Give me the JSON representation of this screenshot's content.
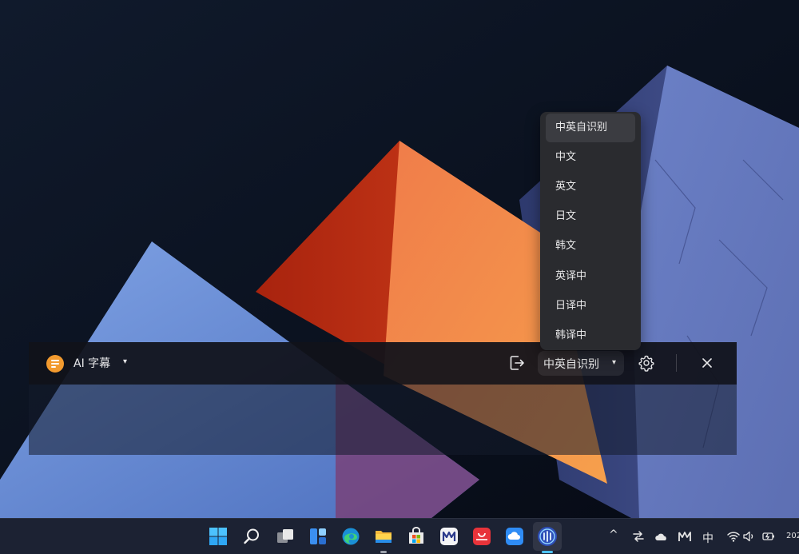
{
  "colors": {
    "accent_orange": "#f29a2e",
    "toolbar_bg": "#101218",
    "dropdown_bg": "#2a2b2f",
    "dropdown_selected": "#3b3c41",
    "taskbar_bg": "#1c2233"
  },
  "subtitle_bar": {
    "logo_icon": "subtitle-logo-icon",
    "title": "AI 字幕",
    "title_caret": "▾",
    "exit_icon": "exit-icon",
    "language_value": "中英自识别",
    "language_caret": "▾",
    "settings_icon": "gear-icon",
    "close_icon": "close-icon"
  },
  "language_dropdown": {
    "items": [
      {
        "label": "中英自识别",
        "selected": true
      },
      {
        "label": "中文",
        "selected": false
      },
      {
        "label": "英文",
        "selected": false
      },
      {
        "label": "日文",
        "selected": false
      },
      {
        "label": "韩文",
        "selected": false
      },
      {
        "label": "英译中",
        "selected": false
      },
      {
        "label": "日译中",
        "selected": false
      },
      {
        "label": "韩译中",
        "selected": false
      }
    ]
  },
  "taskbar": {
    "apps": [
      {
        "name": "start-icon"
      },
      {
        "name": "search-icon"
      },
      {
        "name": "task-view-icon"
      },
      {
        "name": "widgets-icon"
      },
      {
        "name": "edge-browser-icon"
      },
      {
        "name": "file-explorer-icon"
      },
      {
        "name": "microsoft-store-icon"
      },
      {
        "name": "huawei-m-icon"
      },
      {
        "name": "huawei-appgallery-icon"
      },
      {
        "name": "cloud-app-icon"
      },
      {
        "name": "ai-subtitle-app-icon"
      }
    ],
    "tray": {
      "chevron": "^",
      "ime_label": "中",
      "clock_partial": "202"
    }
  }
}
